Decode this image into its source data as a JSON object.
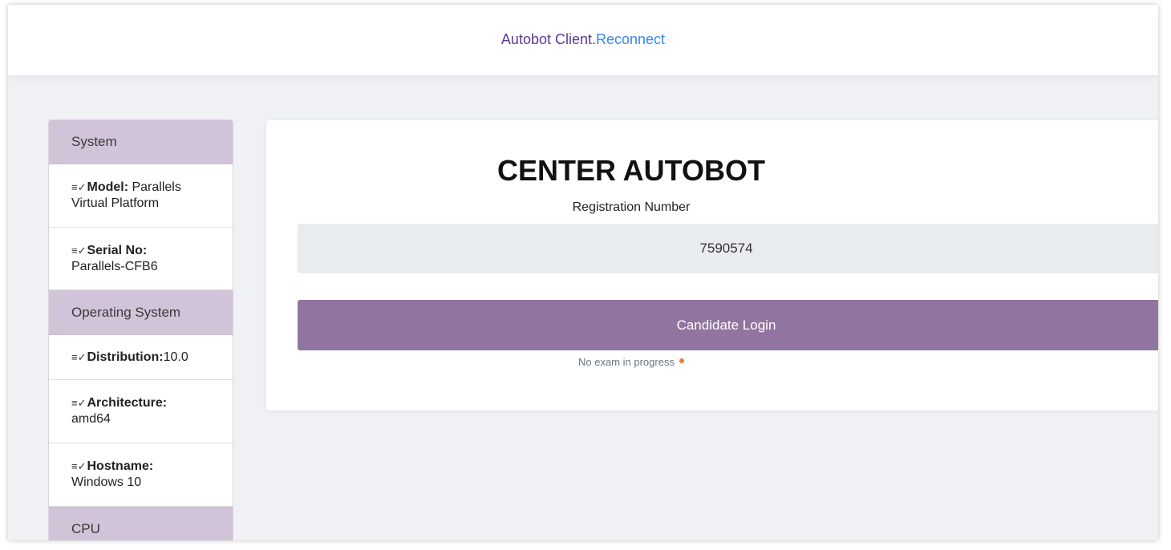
{
  "header": {
    "app_name": "Autobot Client.",
    "reconnect_label": "Reconnect"
  },
  "sidebar": {
    "sections": [
      {
        "title": "System",
        "items": [
          {
            "key": "Model:",
            "value": "Parallels Virtual Platform"
          },
          {
            "key": "Serial No:",
            "value": "Parallels-CFB6"
          }
        ]
      },
      {
        "title": "Operating System",
        "items": [
          {
            "key": "Distribution:",
            "value": "10.0"
          },
          {
            "key": "Architecture:",
            "value": "amd64"
          },
          {
            "key": "Hostname:",
            "value": "Windows 10"
          }
        ]
      },
      {
        "title": "CPU",
        "items": []
      }
    ],
    "item_icon": "≡✓"
  },
  "main": {
    "title": "CENTER AUTOBOT",
    "registration_label": "Registration Number",
    "registration_value": "7590574",
    "login_button": "Candidate Login",
    "status_text": "No exam in progress",
    "status_color": "#f07a3a"
  },
  "colors": {
    "accent": "#9274a0",
    "sidebar_header": "#d1c3d8",
    "link": "#3a86e8"
  }
}
